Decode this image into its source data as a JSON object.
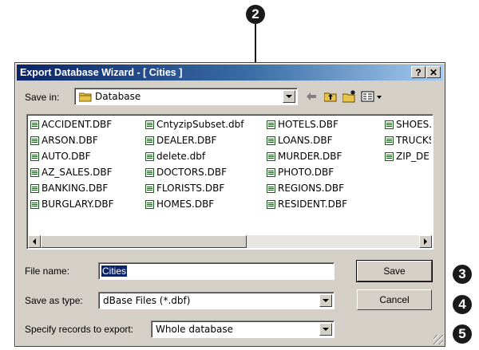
{
  "callouts": {
    "c2": "2",
    "c3": "3",
    "c4": "4",
    "c5": "5"
  },
  "dialog": {
    "title": "Export Database Wizard - [ Cities ]",
    "help_label": "?",
    "close_label": "✕",
    "save_in_label": "Save in:",
    "save_in_value": "Database",
    "file_name_label": "File name:",
    "file_name_value": "Cities",
    "save_as_type_label": "Save as type:",
    "save_as_type_value": "dBase Files (*.dbf)",
    "records_label": "Specify records to export:",
    "records_value": "Whole database",
    "save_button": "Save",
    "cancel_button": "Cancel"
  },
  "files": {
    "col1": [
      "ACCIDENT.DBF",
      "ARSON.DBF",
      "AUTO.DBF",
      "AZ_SALES.DBF",
      "BANKING.DBF",
      "BURGLARY.DBF"
    ],
    "col2": [
      "CntyzipSubset.dbf",
      "DEALER.DBF",
      "delete.dbf",
      "DOCTORS.DBF",
      "FLORISTS.DBF",
      "HOMES.DBF"
    ],
    "col3": [
      "HOTELS.DBF",
      "LOANS.DBF",
      "MURDER.DBF",
      "PHOTO.DBF",
      "REGIONS.DBF",
      "RESIDENT.DBF"
    ],
    "col4": [
      "SHOES.",
      "TRUCKS",
      "ZIP_DE"
    ]
  },
  "icons": {
    "folder": "folder-icon",
    "back": "back-arrow-icon",
    "up": "up-folder-icon",
    "new_folder": "new-folder-icon",
    "view_menu": "view-menu-icon",
    "file": "dbf-file-icon"
  },
  "colors": {
    "titlebar_start": "#0a246a",
    "titlebar_end": "#a6caf0",
    "dialog_face": "#d4d0c8",
    "selection": "#0a246a"
  }
}
